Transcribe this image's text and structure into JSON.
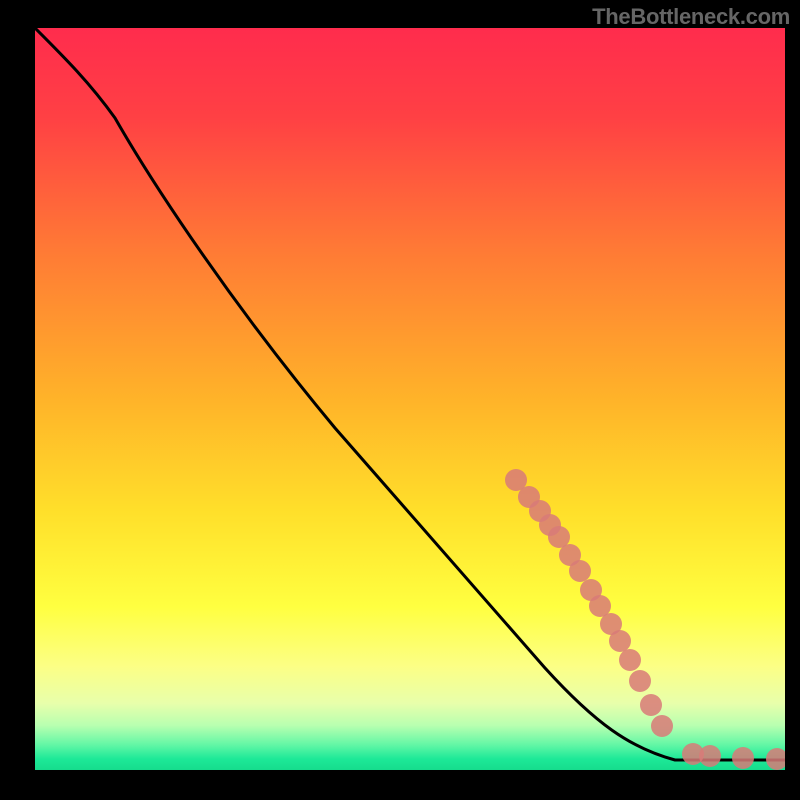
{
  "watermark": "TheBottleneck.com",
  "colors": {
    "point_fill": "#d87a78",
    "curve_stroke": "#000000",
    "gradient_top": "#ff2c4d",
    "gradient_mid": "#ffdf2a",
    "gradient_bottom": "#16dc8d"
  },
  "chart_data": {
    "type": "line",
    "title": "",
    "xlabel": "",
    "ylabel": "",
    "xlim": [
      0,
      100
    ],
    "ylim": [
      0,
      100
    ],
    "series": [
      {
        "name": "curve",
        "style": "line",
        "x": [
          0,
          4,
          8,
          11,
          16,
          27,
          40,
          68,
          75,
          79,
          85,
          100
        ],
        "y": [
          100,
          96,
          93,
          88,
          79,
          62,
          46,
          14,
          7,
          3,
          1.3,
          1.3
        ]
      },
      {
        "name": "points",
        "style": "scatter",
        "x": [
          64.1,
          65.9,
          67.3,
          68.7,
          69.9,
          71.3,
          72.7,
          74.1,
          75.3,
          76.8,
          78.0,
          79.3,
          80.7,
          82.1,
          83.6,
          87.7,
          90.0,
          94.4,
          98.9
        ],
        "y": [
          39.1,
          36.8,
          34.9,
          33.0,
          31.4,
          29.0,
          26.8,
          24.3,
          22.1,
          19.7,
          17.4,
          14.8,
          12.0,
          8.8,
          5.9,
          2.2,
          1.9,
          1.6,
          1.5
        ]
      }
    ],
    "background": {
      "type": "vertical-gradient",
      "stops": [
        {
          "pos": 0.0,
          "color": "#ff2c4d"
        },
        {
          "pos": 0.3,
          "color": "#ff7a35"
        },
        {
          "pos": 0.65,
          "color": "#ffdf2a"
        },
        {
          "pos": 0.86,
          "color": "#fcff85"
        },
        {
          "pos": 0.97,
          "color": "#1de998"
        },
        {
          "pos": 1.0,
          "color": "#16dc8d"
        }
      ]
    }
  }
}
